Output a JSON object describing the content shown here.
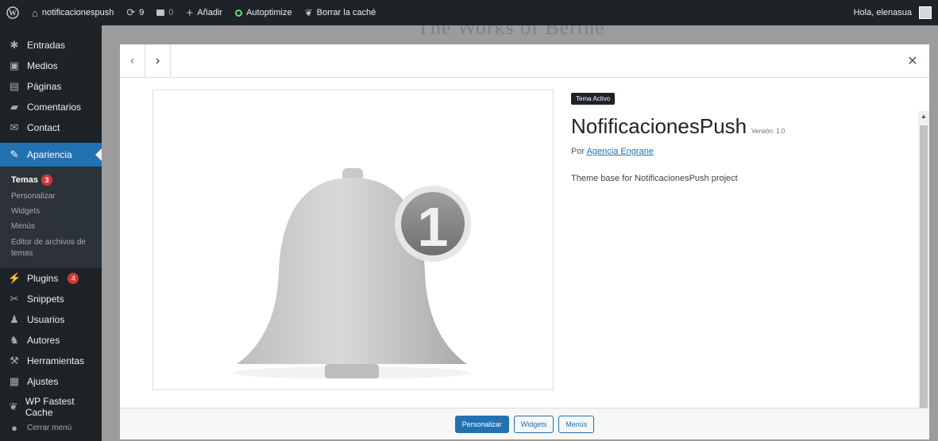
{
  "adminbar": {
    "site_name": "notificacionespush",
    "updates_count": "9",
    "comments_count": "0",
    "add_new": "Añadir",
    "autoptimize": "Autoptimize",
    "clear_cache": "Borrar la caché",
    "greeting": "Hola, elenasua"
  },
  "sidebar": {
    "items_top": [
      {
        "label": "Entradas",
        "icon": "pin-icon"
      },
      {
        "label": "Medios",
        "icon": "media-icon"
      },
      {
        "label": "Páginas",
        "icon": "pages-icon"
      },
      {
        "label": "Comentarios",
        "icon": "comments-icon"
      },
      {
        "label": "Contact",
        "icon": "mail-icon"
      }
    ],
    "current": "Apariencia",
    "submenu": {
      "temas": "Temas",
      "temas_badge": "3",
      "personalizar": "Personalizar",
      "widgets": "Widgets",
      "menus": "Menús",
      "editor": "Editor de archivos de temas"
    },
    "items_bottom": [
      {
        "label": "Plugins",
        "icon": "plugins-icon",
        "badge": "4"
      },
      {
        "label": "Snippets",
        "icon": "scissors-icon"
      },
      {
        "label": "Usuarios",
        "icon": "users-icon"
      },
      {
        "label": "Autores",
        "icon": "authors-icon"
      },
      {
        "label": "Herramientas",
        "icon": "tools-icon"
      },
      {
        "label": "Ajustes",
        "icon": "settings-icon"
      },
      {
        "label": "WP Fastest Cache",
        "icon": "cheetah-icon"
      },
      {
        "label": "Cerrar menú",
        "icon": "collapse-icon"
      }
    ]
  },
  "background": {
    "site_title": "The Works of Berthe"
  },
  "theme": {
    "active_label": "Tema Activo",
    "name": "NofificacionesPush",
    "version": "Versión: 1.0",
    "author_prefix": "Por",
    "author": "Agencia Engrane",
    "description": "Theme base for NotificacionesPush project",
    "screenshot_number": "1"
  },
  "footer": {
    "customize": "Personalizar",
    "widgets": "Widgets",
    "menus": "Menús"
  },
  "colors": {
    "accent": "#2271b1",
    "adminbar": "#1d2327",
    "badge": "#d63638"
  }
}
